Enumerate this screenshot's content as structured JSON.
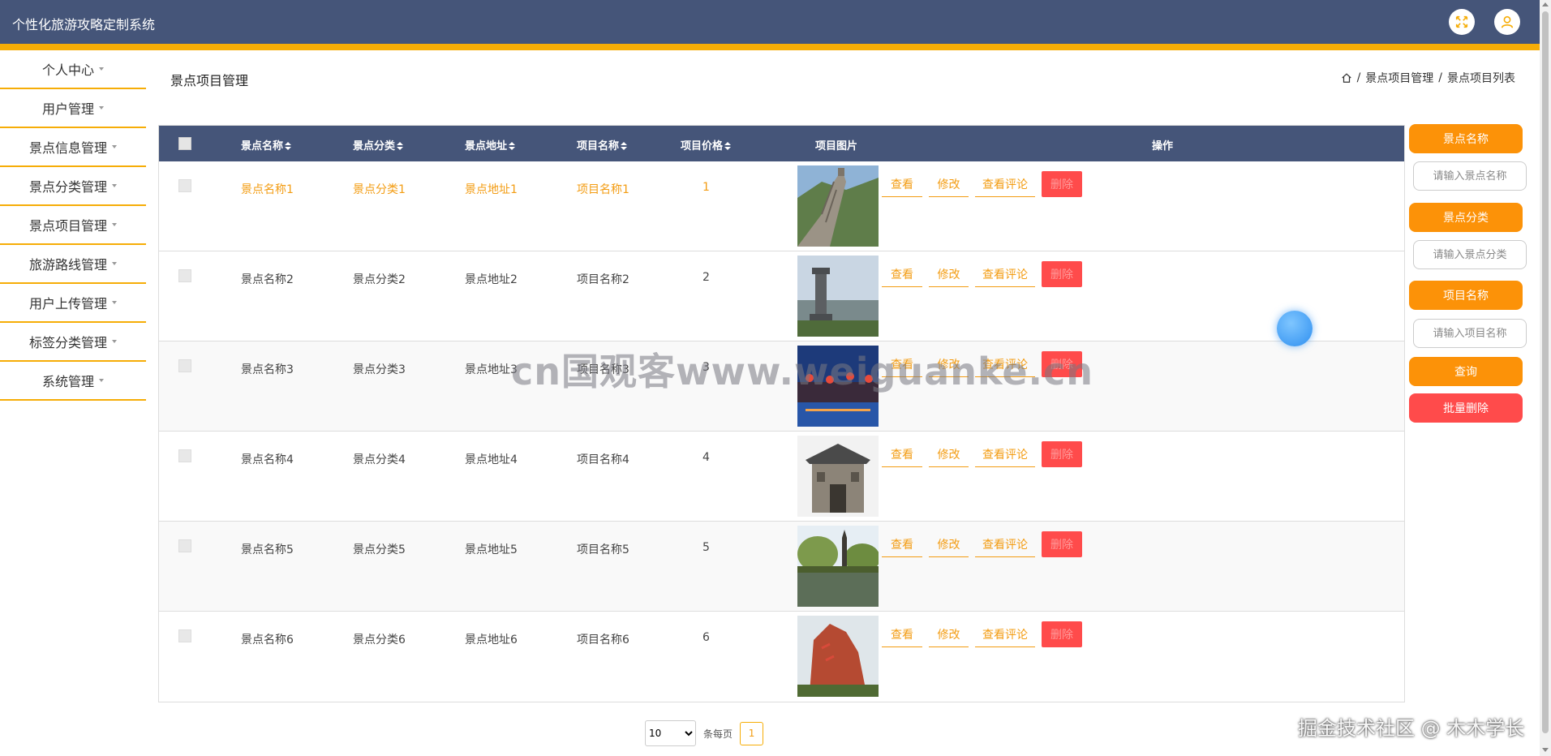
{
  "header": {
    "title": "个性化旅游攻略定制系统",
    "fullscreen_icon": "expand-icon",
    "user_icon": "user-icon"
  },
  "sidebar": {
    "items": [
      {
        "label": "个人中心"
      },
      {
        "label": "用户管理"
      },
      {
        "label": "景点信息管理"
      },
      {
        "label": "景点分类管理"
      },
      {
        "label": "景点项目管理"
      },
      {
        "label": "旅游路线管理"
      },
      {
        "label": "用户上传管理"
      },
      {
        "label": "标签分类管理"
      },
      {
        "label": "系统管理"
      }
    ]
  },
  "page": {
    "title": "景点项目管理",
    "breadcrumb": [
      "景点项目管理",
      "景点项目列表"
    ],
    "breadcrumb_sep": "/"
  },
  "table": {
    "columns": [
      "景点名称",
      "景点分类",
      "景点地址",
      "项目名称",
      "项目价格",
      "项目图片",
      "操作"
    ],
    "rows": [
      {
        "name": "景点名称1",
        "category": "景点分类1",
        "address": "景点地址1",
        "project": "项目名称1",
        "price": "1",
        "image": "great-wall"
      },
      {
        "name": "景点名称2",
        "category": "景点分类2",
        "address": "景点地址2",
        "project": "项目名称2",
        "price": "2",
        "image": "monument-city"
      },
      {
        "name": "景点名称3",
        "category": "景点分类3",
        "address": "景点地址3",
        "project": "项目名称3",
        "price": "3",
        "image": "night-canal"
      },
      {
        "name": "景点名称4",
        "category": "景点分类4",
        "address": "景点地址4",
        "project": "项目名称4",
        "price": "4",
        "image": "ancient-gate"
      },
      {
        "name": "景点名称5",
        "category": "景点分类5",
        "address": "景点地址5",
        "project": "项目名称5",
        "price": "5",
        "image": "lake-pagoda"
      },
      {
        "name": "景点名称6",
        "category": "景点分类6",
        "address": "景点地址6",
        "project": "项目名称6",
        "price": "6",
        "image": "red-rock"
      }
    ],
    "actions": {
      "view": "查看",
      "edit": "修改",
      "comments": "查看评论",
      "delete": "删除"
    }
  },
  "search": {
    "name_label": "景点名称",
    "name_placeholder": "请输入景点名称",
    "category_label": "景点分类",
    "category_placeholder": "请输入景点分类",
    "project_label": "项目名称",
    "project_placeholder": "请输入项目名称",
    "query_label": "查询",
    "batch_delete_label": "批量删除"
  },
  "pagination": {
    "page_size": "10",
    "per_page_label": "条每页",
    "current_page": "1"
  },
  "watermarks": {
    "center": "cn国观客www.weiguanke.cn",
    "corner": "掘金技术社区 @ 木木学长"
  },
  "colors": {
    "header": "#455579",
    "accent": "#f6ad07",
    "action": "#f39c12",
    "danger": "#ff4b4b"
  }
}
